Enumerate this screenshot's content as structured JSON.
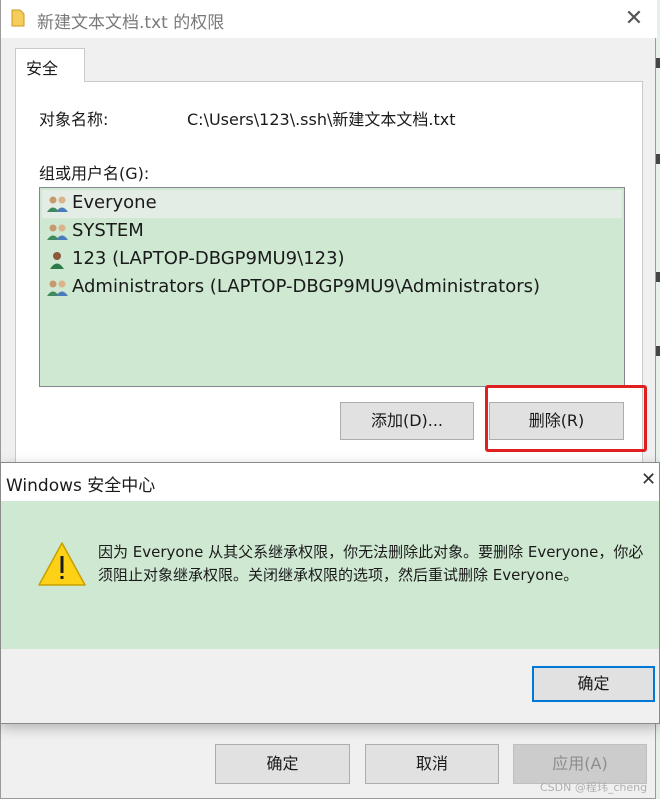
{
  "window": {
    "title": "新建文本文档.txt 的权限",
    "tab_label": "安全",
    "object_name_label": "对象名称:",
    "object_path": "C:\\Users\\123\\.ssh\\新建文本文档.txt",
    "group_label": "组或用户名(G):",
    "users": [
      {
        "name": "Everyone",
        "icon": "user-group-icon",
        "selected": true
      },
      {
        "name": "SYSTEM",
        "icon": "user-group-icon",
        "selected": false
      },
      {
        "name": "123 (LAPTOP-DBGP9MU9\\123)",
        "icon": "user-icon",
        "selected": false
      },
      {
        "name": "Administrators (LAPTOP-DBGP9MU9\\Administrators)",
        "icon": "user-group-icon",
        "selected": false
      }
    ],
    "add_button": "添加(D)...",
    "remove_button": "删除(R)",
    "ok_button": "确定",
    "cancel_button": "取消",
    "apply_button": "应用(A)"
  },
  "alert": {
    "title": "Windows 安全中心",
    "message": "因为 Everyone 从其父系继承权限，你无法删除此对象。要删除 Everyone，你必须阻止对象继承权限。关闭继承权限的选项，然后重试删除 Everyone。",
    "ok_button": "确定",
    "icon": "warning-icon"
  },
  "watermark": "CSDN @程玮_cheng",
  "colors": {
    "list_background": "#cfe8d2",
    "highlight_border": "#e02020",
    "focus_border": "#0078d7"
  }
}
